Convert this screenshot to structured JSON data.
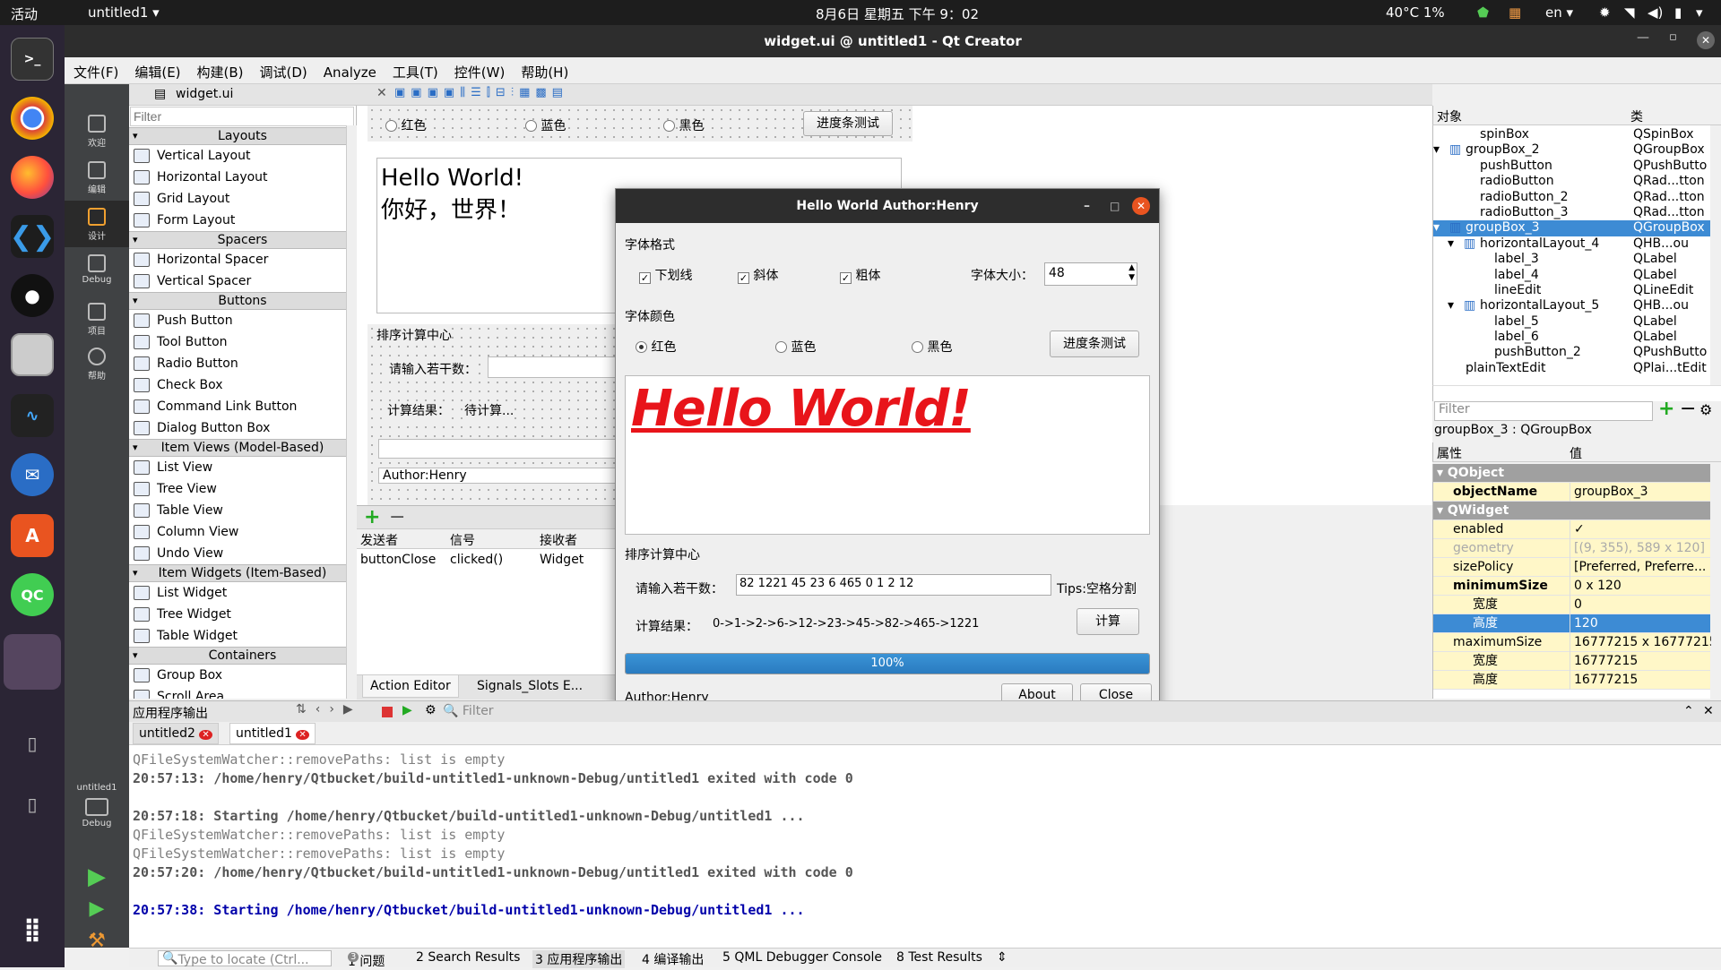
{
  "topbar": {
    "activities": "活动",
    "app": "untitled1",
    "clock": "8月6日 星期五 下午 9：02",
    "temp": "40°C 1%",
    "lang": "en"
  },
  "window_title": "widget.ui @ untitled1 - Qt Creator",
  "menus": [
    "文件(F)",
    "编辑(E)",
    "构建(B)",
    "调试(D)",
    "Analyze",
    "工具(T)",
    "控件(W)",
    "帮助(H)"
  ],
  "modes": [
    "欢迎",
    "编辑",
    "设计",
    "Debug",
    "项目",
    "帮助"
  ],
  "kit": {
    "project": "untitled1",
    "config": "Debug"
  },
  "editor_tab": "widget.ui",
  "widgetbox": {
    "filter_placeholder": "Filter",
    "categories": [
      {
        "label": "Layouts",
        "items": [
          "Vertical Layout",
          "Horizontal Layout",
          "Grid Layout",
          "Form Layout"
        ]
      },
      {
        "label": "Spacers",
        "items": [
          "Horizontal Spacer",
          "Vertical Spacer"
        ]
      },
      {
        "label": "Buttons",
        "items": [
          "Push Button",
          "Tool Button",
          "Radio Button",
          "Check Box",
          "Command Link Button",
          "Dialog Button Box"
        ]
      },
      {
        "label": "Item Views (Model-Based)",
        "items": [
          "List View",
          "Tree View",
          "Table View",
          "Column View",
          "Undo View"
        ]
      },
      {
        "label": "Item Widgets (Item-Based)",
        "items": [
          "List Widget",
          "Tree Widget",
          "Table Widget"
        ]
      },
      {
        "label": "Containers",
        "items": [
          "Group Box",
          "Scroll Area"
        ]
      }
    ]
  },
  "form": {
    "radio_red": "红色",
    "radio_blue": "蓝色",
    "radio_black": "黑色",
    "progress_btn": "进度条测试",
    "text_line1": "Hello World!",
    "text_line2": "你好，世界！",
    "group_sort": "排序计算中心",
    "input_label": "请输入若干数：",
    "result_label": "计算结果：",
    "result_value": "待计算...",
    "author": "Author:Henry"
  },
  "signals": {
    "tab1": "Action Editor",
    "tab2": "Signals_Slots E...",
    "headers": [
      "发送者",
      "信号",
      "接收者"
    ],
    "row": [
      "buttonClose",
      "clicked()",
      "Widget"
    ]
  },
  "dialog": {
    "title": "Hello World Author:Henry",
    "font_group": "字体格式",
    "underline": "下划线",
    "italic": "斜体",
    "bold": "粗体",
    "size_label": "字体大小：",
    "size_value": "48",
    "color_group": "字体颜色",
    "red": "红色",
    "blue": "蓝色",
    "black": "黑色",
    "progress_btn": "进度条测试",
    "hello": "Hello World!",
    "sort_group": "排序计算中心",
    "input_label": "请输入若干数：",
    "input_value": "82 1221 45 23 6 465 0 1 2 12",
    "tips": "Tips:空格分割",
    "result_label": "计算结果：",
    "result_value": "0->1->2->6->12->23->45->82->465->1221",
    "calc_btn": "计算",
    "progress": 100,
    "progress_text": "100%",
    "author": "Author:Henry",
    "about": "About",
    "close": "Close",
    "text_color": "#e8141a"
  },
  "objects": {
    "headers": [
      "对象",
      "类"
    ],
    "rows": [
      {
        "name": "spinBox",
        "cls": "QSpinBox",
        "indent": 3
      },
      {
        "name": "groupBox_2",
        "cls": "QGroupBox",
        "indent": 1,
        "arrow": "▾"
      },
      {
        "name": "pushButton",
        "cls": "QPushButto",
        "indent": 3
      },
      {
        "name": "radioButton",
        "cls": "QRad...tton",
        "indent": 3
      },
      {
        "name": "radioButton_2",
        "cls": "QRad...tton",
        "indent": 3
      },
      {
        "name": "radioButton_3",
        "cls": "QRad...tton",
        "indent": 3
      },
      {
        "name": "groupBox_3",
        "cls": "QGroupBox",
        "indent": 1,
        "arrow": "▾",
        "selected": true
      },
      {
        "name": "horizontalLayout_4",
        "cls": "QHB...ou",
        "indent": 2,
        "arrow": "▾"
      },
      {
        "name": "label_3",
        "cls": "QLabel",
        "indent": 4
      },
      {
        "name": "label_4",
        "cls": "QLabel",
        "indent": 4
      },
      {
        "name": "lineEdit",
        "cls": "QLineEdit",
        "indent": 4
      },
      {
        "name": "horizontalLayout_5",
        "cls": "QHB...ou",
        "indent": 2,
        "arrow": "▾"
      },
      {
        "name": "label_5",
        "cls": "QLabel",
        "indent": 4
      },
      {
        "name": "label_6",
        "cls": "QLabel",
        "indent": 4
      },
      {
        "name": "pushButton_2",
        "cls": "QPushButto",
        "indent": 4
      },
      {
        "name": "plainTextEdit",
        "cls": "QPlai...tEdit",
        "indent": 2
      }
    ],
    "filter": "Filter"
  },
  "props": {
    "selection": "groupBox_3 : QGroupBox",
    "headers": [
      "属性",
      "值"
    ],
    "rows": [
      {
        "name": "QObject",
        "value": "",
        "section": true
      },
      {
        "name": "objectName",
        "value": "groupBox_3",
        "bold": true,
        "yellow": true
      },
      {
        "name": "QWidget",
        "value": "",
        "section": true
      },
      {
        "name": "enabled",
        "value": "✓",
        "yellow": true
      },
      {
        "name": "geometry",
        "value": "[(9, 355), 589 x 120]",
        "grey": true,
        "yellow": true
      },
      {
        "name": "sizePolicy",
        "value": "[Preferred, Preferre...",
        "yellow": true
      },
      {
        "name": "minimumSize",
        "value": "0 x 120",
        "bold": true,
        "yellow": true
      },
      {
        "name": "宽度",
        "value": "0",
        "sub": true,
        "yellow": true
      },
      {
        "name": "高度",
        "value": "120",
        "sub": true,
        "selected": true
      },
      {
        "name": "maximumSize",
        "value": "16777215 x 16777215",
        "yellow": true
      },
      {
        "name": "宽度",
        "value": "16777215",
        "sub": true,
        "yellow": true
      },
      {
        "name": "高度",
        "value": "16777215",
        "sub": true,
        "yellow": true
      }
    ]
  },
  "output": {
    "title": "应用程序输出",
    "filter": "Filter",
    "tabs": [
      "untitled2",
      "untitled1"
    ],
    "lines": [
      {
        "t": "QFileSystemWatcher::removePaths: list is empty",
        "c": "grey"
      },
      {
        "t": "20:57:13: /home/henry/Qtbucket/build-untitled1-unknown-Debug/untitled1 exited with code 0",
        "c": "bold"
      },
      {
        "t": "",
        "c": "grey"
      },
      {
        "t": "20:57:18: Starting /home/henry/Qtbucket/build-untitled1-unknown-Debug/untitled1 ...",
        "c": "bold"
      },
      {
        "t": "QFileSystemWatcher::removePaths: list is empty",
        "c": "grey"
      },
      {
        "t": "QFileSystemWatcher::removePaths: list is empty",
        "c": "grey"
      },
      {
        "t": "20:57:20: /home/henry/Qtbucket/build-untitled1-unknown-Debug/untitled1 exited with code 0",
        "c": "bold"
      },
      {
        "t": "",
        "c": "grey"
      },
      {
        "t": "20:57:38: Starting /home/henry/Qtbucket/build-untitled1-unknown-Debug/untitled1 ...",
        "c": "blue"
      }
    ]
  },
  "status": {
    "locate": "Type to locate (Ctrl...",
    "items": [
      "1 问题",
      "2 Search Results",
      "3 应用程序输出",
      "4 编译输出",
      "5 QML Debugger Console",
      "8 Test Results"
    ],
    "issues_count": "3"
  }
}
